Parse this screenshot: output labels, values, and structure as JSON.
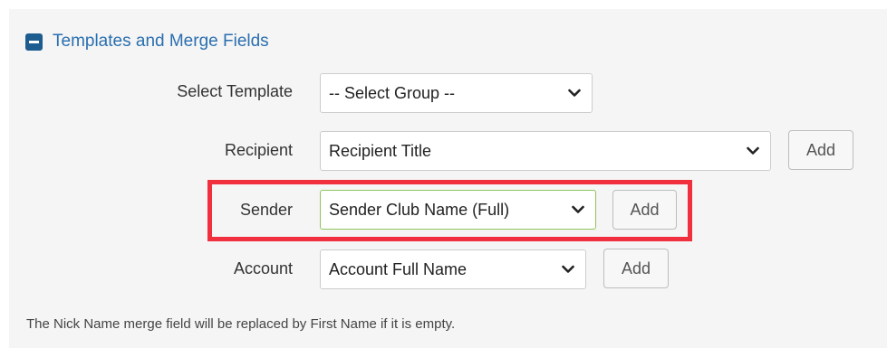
{
  "section": {
    "title": "Templates and Merge Fields",
    "icon": "minus-square-icon"
  },
  "rows": {
    "template": {
      "label": "Select Template",
      "value": "-- Select Group --"
    },
    "recipient": {
      "label": "Recipient",
      "value": "Recipient Title",
      "button": "Add"
    },
    "sender": {
      "label": "Sender",
      "value": "Sender Club Name (Full)",
      "button": "Add"
    },
    "account": {
      "label": "Account",
      "value": "Account Full Name",
      "button": "Add"
    }
  },
  "note": "The Nick Name merge field will be replaced by First Name if it is empty.",
  "colors": {
    "accent": "#2a6fb0",
    "icon": "#1d5c8f",
    "highlight": "#f0303f",
    "focused_border": "#8fc45a"
  }
}
